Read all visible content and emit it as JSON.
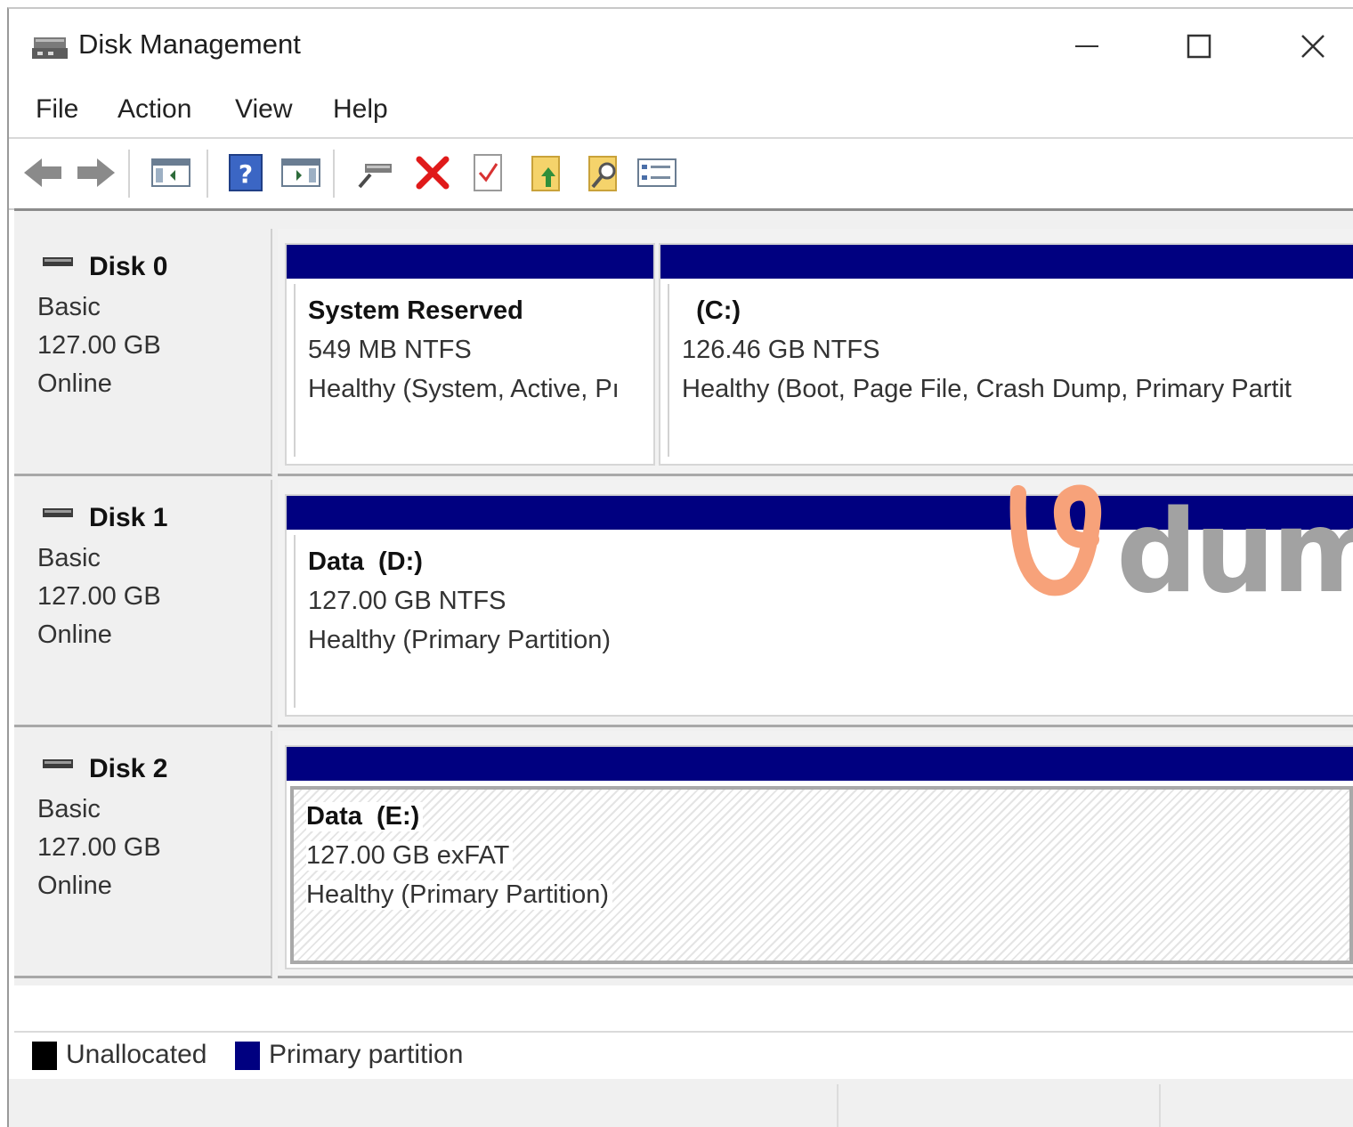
{
  "window": {
    "title": "Disk Management",
    "controls": {
      "minimize": "—",
      "maximize": "☐",
      "close": "✕"
    }
  },
  "menu": [
    "File",
    "Action",
    "View",
    "Help"
  ],
  "toolbar": {
    "icons": [
      "back-arrow-icon",
      "forward-arrow-icon",
      "show-hide-console-tree-icon",
      "help-icon",
      "show-hide-action-pane-icon",
      "connect-virtual-disk-icon",
      "delete-icon",
      "check-disk-icon",
      "rescan-disks-icon",
      "search-icon",
      "properties-icon"
    ]
  },
  "disks": [
    {
      "name": "Disk 0",
      "type": "Basic",
      "size": "127.00 GB",
      "status": "Online",
      "partitions": [
        {
          "name": "System Reserved",
          "size": "549 MB NTFS",
          "status": "Healthy (System, Active, Pı"
        },
        {
          "name": "  (C:)",
          "size": "126.46 GB NTFS",
          "status": "Healthy (Boot, Page File, Crash Dump, Primary Partit"
        }
      ]
    },
    {
      "name": "Disk 1",
      "type": "Basic",
      "size": "127.00 GB",
      "status": "Online",
      "partitions": [
        {
          "name": "Data  (D:)",
          "size": "127.00 GB NTFS",
          "status": "Healthy (Primary Partition)"
        }
      ]
    },
    {
      "name": "Disk 2",
      "type": "Basic",
      "size": "127.00 GB",
      "status": "Online",
      "partitions": [
        {
          "name": "Data  (E:)",
          "size": "127.00 GB exFAT",
          "status": "Healthy (Primary Partition)",
          "selected": true
        }
      ]
    }
  ],
  "legend": [
    {
      "label": "Unallocated",
      "color": "#000000"
    },
    {
      "label": "Primary partition",
      "color": "#000080"
    }
  ],
  "watermark": {
    "text": "dum",
    "accent": "#f7a27a"
  },
  "colors": {
    "partition_bar": "#000080"
  }
}
